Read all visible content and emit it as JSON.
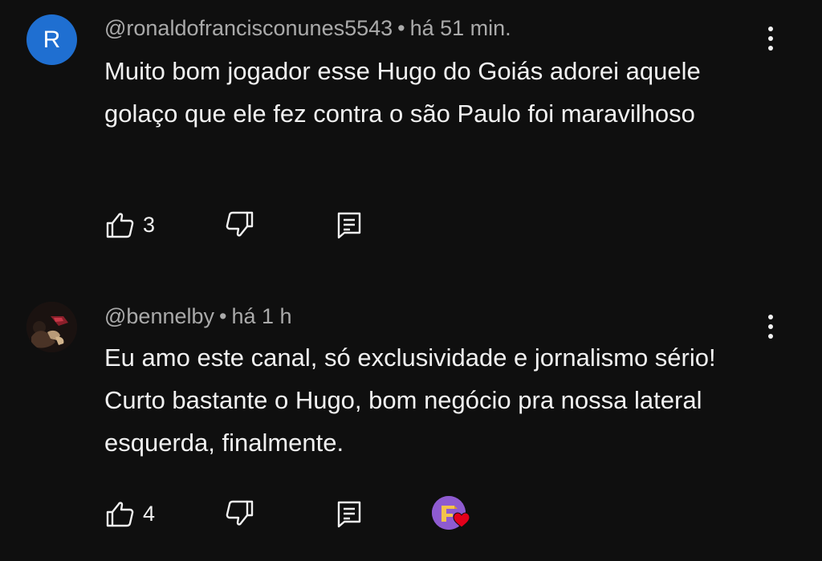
{
  "comments": [
    {
      "avatar_letter": "R",
      "avatar_color": "#1f6fd1",
      "author": "@ronaldofrancisconunes5543",
      "separator": "•",
      "time": "há 51 min.",
      "text": "Muito bom jogador esse Hugo do Goiás adorei aquele golaço que ele fez contra o são Paulo foi maravilhoso",
      "like_count": "3",
      "icons": {
        "like": "thumb-up-icon",
        "dislike": "thumb-down-icon",
        "reply": "reply-icon",
        "menu": "more-vert-icon"
      }
    },
    {
      "avatar_letter": "",
      "author": "@bennelby",
      "separator": "•",
      "time": "há 1 h",
      "text": "Eu amo este canal, só exclusividade e jornalismo sério! Curto bastante o Hugo, bom negócio pra nossa lateral esquerda, finalmente.",
      "like_count": "4",
      "creator_heart": true,
      "icons": {
        "like": "thumb-up-icon",
        "dislike": "thumb-down-icon",
        "reply": "reply-icon",
        "menu": "more-vert-icon",
        "heart": "creator-heart-icon"
      }
    }
  ],
  "colors": {
    "background": "#0f0f0f",
    "text": "#f1f1f1",
    "meta": "#aaaaaa",
    "heart": "#e3001b"
  }
}
